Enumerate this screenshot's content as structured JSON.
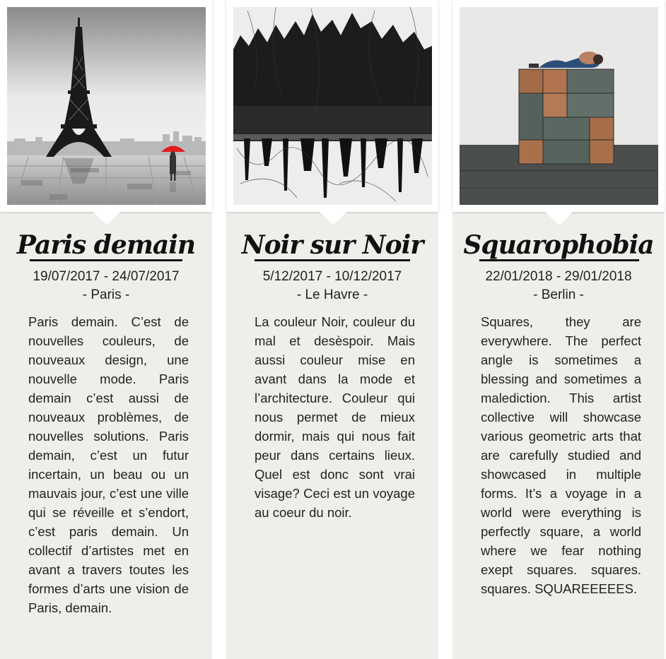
{
  "events": [
    {
      "title": "Paris demain",
      "dates": "19/07/2017 - 24/07/2017",
      "city": "- Paris -",
      "description": "Paris demain. C’est de nouvelles couleurs, de nouveaux design, une nouvelle mode. Paris demain c’est aussi de nouveaux problèmes, de nouvelles solutions. Paris demain, c’est un futur incertain, un beau ou un mauvais jour, c’est une ville qui se réveille et s’endort, c’est paris demain. Un collectif d’artistes met en avant a travers toutes les formes d’arts une vision de Paris, demain.",
      "image": "eiffel-tower-red-umbrella-image"
    },
    {
      "title": "Noir sur Noir",
      "dates": "5/12/2017 - 10/12/2017",
      "city": "- Le Havre -",
      "description": "La couleur Noir, couleur du mal et desèspoir. Mais aussi couleur mise en avant dans la mode et l’architecture. Couleur qui nous permet de mieux dormir, mais qui nous fait peur dans certains lieux. Quel est donc sont vrai visage? Ceci est un voyage au coeur du noir.",
      "image": "black-abstract-ink-image"
    },
    {
      "title": "Squarophobia",
      "dates": "22/01/2018 - 29/01/2018",
      "city": "- Berlin -",
      "description": "Squares, they are everywhere. The perfect angle is sometimes a blessing and sometimes a malediction. This artist collective will showcase various geometric arts that are carefully studied and showcased in multiple forms. It’s a voyage in a world were everything is perfectly square, a world where we fear nothing exept squares. squares. squares. SQUAREEEEES.",
      "image": "stacked-cubes-sculpture-image"
    }
  ]
}
